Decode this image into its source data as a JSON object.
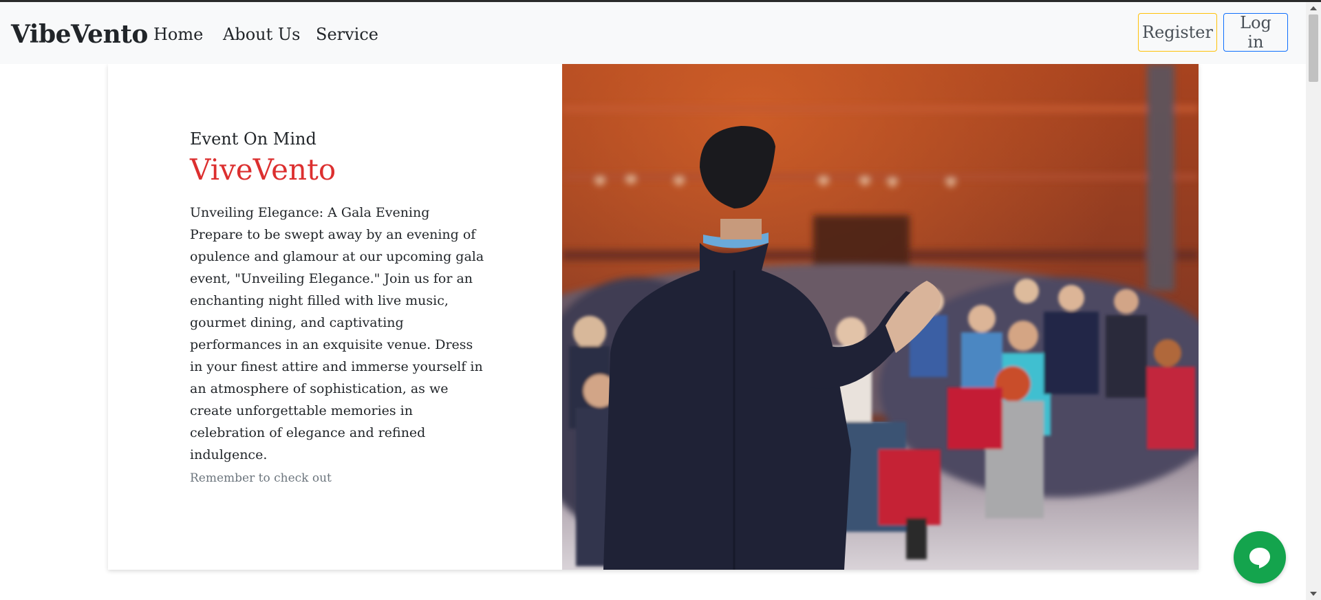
{
  "navbar": {
    "brand": "VibeVento",
    "links": [
      "Home",
      "About Us",
      "Service"
    ],
    "register_label": "Register",
    "login_label": "Log in"
  },
  "hero": {
    "subtitle": "Event On Mind",
    "title": "ViveVento",
    "description": "Unveiling Elegance: A Gala Evening Prepare to be swept away by an evening of opulence and glamour at our upcoming gala event, \"Unveiling Elegance.\" Join us for an enchanting night filled with live music, gourmet dining, and captivating performances in an exquisite venue. Dress in your finest attire and immerse yourself in an atmosphere of sophistication, as we create unforgettable memories in celebration of elegance and refined indulgence.",
    "note": "Remember to check out",
    "image": "conference-speaker-photo"
  },
  "chat": {
    "icon": "chat-bubble-icon"
  },
  "colors": {
    "accent_red": "#dc2f2f",
    "register_border": "#ffc107",
    "login_border": "#0d6efd",
    "chat_green": "#14a44d",
    "navbar_bg": "#f8f9fa"
  }
}
